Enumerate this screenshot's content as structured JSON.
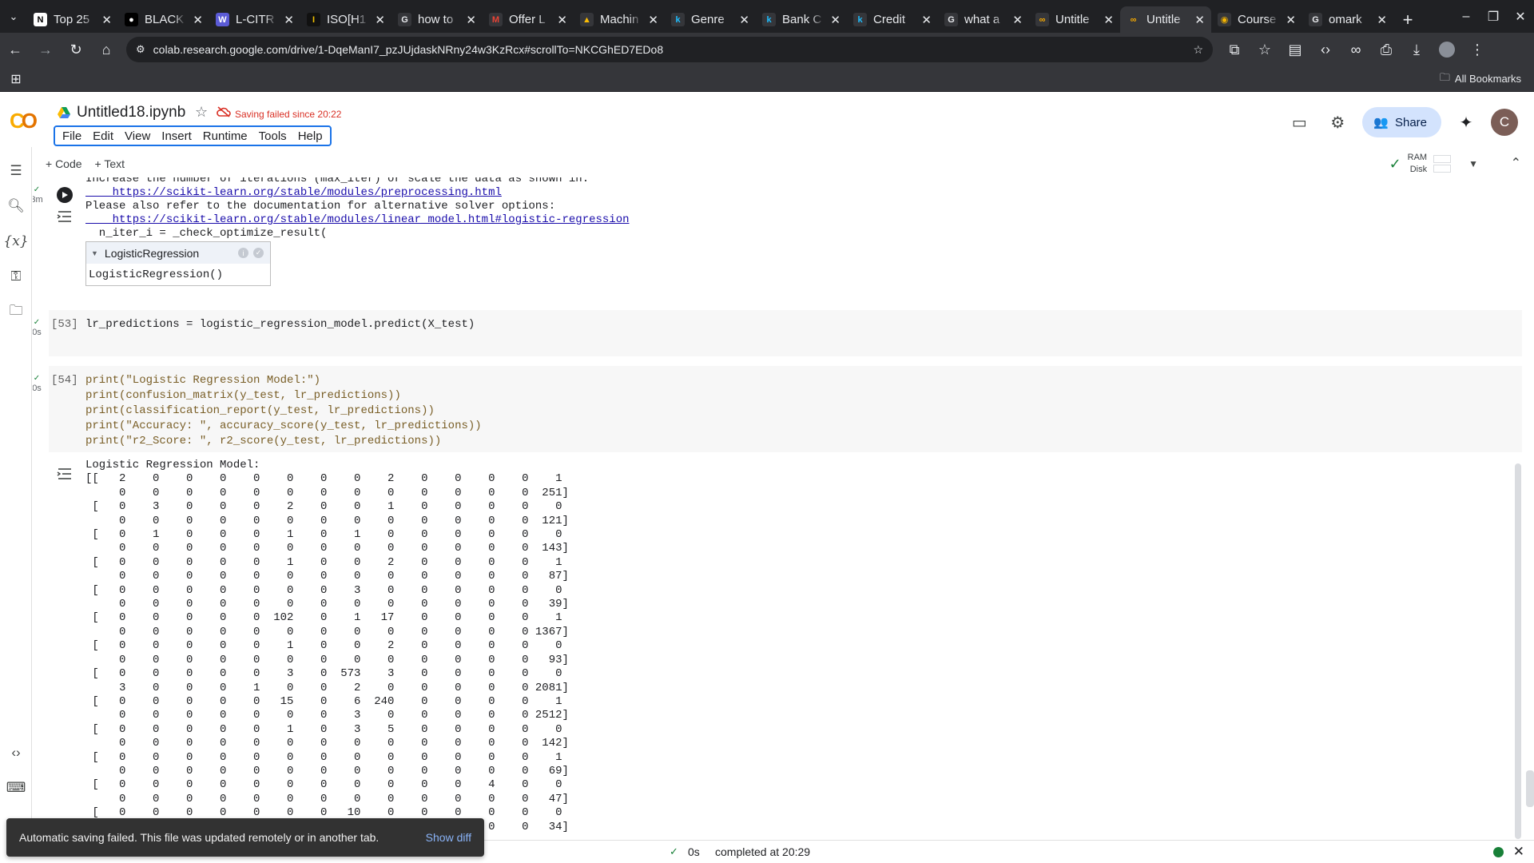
{
  "browser": {
    "tabs": [
      {
        "label": "Top 25",
        "icon": "notion-icon",
        "icon_bg": "#ffffff",
        "icon_fg": "#000000",
        "glyph": "N",
        "active": false
      },
      {
        "label": "BLACK",
        "icon": "github-icon",
        "icon_bg": "#000000",
        "icon_fg": "#ffffff",
        "glyph": "●",
        "active": false
      },
      {
        "label": "L-CITR",
        "icon": "w-icon",
        "icon_bg": "#5b5bd6",
        "icon_fg": "#ffffff",
        "glyph": "W",
        "active": false
      },
      {
        "label": "ISO[H1",
        "icon": "ieee-icon",
        "icon_bg": "#111111",
        "icon_fg": "#f2c200",
        "glyph": "I",
        "active": false
      },
      {
        "label": "how to",
        "icon": "google-icon",
        "icon_bg": "#35363a",
        "icon_fg": "#e8eaed",
        "glyph": "G",
        "active": false
      },
      {
        "label": "Offer L",
        "icon": "gmail-icon",
        "icon_bg": "#35363a",
        "icon_fg": "#ea4335",
        "glyph": "M",
        "active": false
      },
      {
        "label": "Machin",
        "icon": "drive-icon",
        "icon_bg": "#35363a",
        "icon_fg": "#fbbc04",
        "glyph": "▲",
        "active": false
      },
      {
        "label": "Genre",
        "icon": "kaggle-icon",
        "icon_bg": "#35363a",
        "icon_fg": "#20beff",
        "glyph": "k",
        "active": false
      },
      {
        "label": "Bank C",
        "icon": "kaggle-icon",
        "icon_bg": "#35363a",
        "icon_fg": "#20beff",
        "glyph": "k",
        "active": false
      },
      {
        "label": "Credit",
        "icon": "kaggle-icon",
        "icon_bg": "#35363a",
        "icon_fg": "#20beff",
        "glyph": "k",
        "active": false
      },
      {
        "label": "what a",
        "icon": "google-icon",
        "icon_bg": "#35363a",
        "icon_fg": "#e8eaed",
        "glyph": "G",
        "active": false
      },
      {
        "label": "Untitle",
        "icon": "colab-icon",
        "icon_bg": "#35363a",
        "icon_fg": "#f9ab00",
        "glyph": "∞",
        "active": false
      },
      {
        "label": "Untitle",
        "icon": "colab-icon",
        "icon_bg": "#35363a",
        "icon_fg": "#f9ab00",
        "glyph": "∞",
        "active": true
      },
      {
        "label": "Course",
        "icon": "coursera-icon",
        "icon_bg": "#35363a",
        "icon_fg": "#f4b400",
        "glyph": "◉",
        "active": false
      },
      {
        "label": "omark",
        "icon": "google-icon",
        "icon_bg": "#35363a",
        "icon_fg": "#e8eaed",
        "glyph": "G",
        "active": false
      }
    ],
    "url": "colab.research.google.com/drive/1-DqeManI7_pzJUjdaskNRny24w3KzRcx#scrollTo=NKCGhED7EDo8",
    "all_bookmarks": "All Bookmarks"
  },
  "colab": {
    "logo": "CO",
    "title": "Untitled18.ipynb",
    "save_status": "Saving failed since 20:22",
    "menu": [
      "File",
      "Edit",
      "View",
      "Insert",
      "Runtime",
      "Tools",
      "Help"
    ],
    "share_label": "Share",
    "user_initial": "C",
    "add_code": "+ Code",
    "add_text": "+ Text",
    "ram_label": "RAM",
    "disk_label": "Disk"
  },
  "prev_output": {
    "time": "3m",
    "lines": [
      {
        "text": "Increase the number of iterations (max_iter) or scale the data as shown in:",
        "link": false
      },
      {
        "text": "    https://scikit-learn.org/stable/modules/preprocessing.html",
        "link": true
      },
      {
        "text": "Please also refer to the documentation for alternative solver options:",
        "link": false
      },
      {
        "text": "    https://scikit-learn.org/stable/modules/linear_model.html#logistic-regression",
        "link": true
      },
      {
        "text": "  n_iter_i = _check_optimize_result(",
        "link": false
      }
    ],
    "model_box_title": "LogisticRegression",
    "model_box_body": "LogisticRegression()"
  },
  "cells": {
    "c53": {
      "prompt": "[53]",
      "time": "0s",
      "code": "lr_predictions = logistic_regression_model.predict(X_test)"
    },
    "c54": {
      "prompt": "[54]",
      "time": "0s",
      "code_lines": [
        "print(\"Logistic Regression Model:\")",
        "print(confusion_matrix(y_test, lr_predictions))",
        "print(classification_report(y_test, lr_predictions))",
        "print(\"Accuracy: \", accuracy_score(y_test, lr_predictions))",
        "print(\"r2_Score: \", r2_score(y_test, lr_predictions))"
      ],
      "output": "Logistic Regression Model:\n[[   2    0    0    0    0    0    0    0    2    0    0    0    0    1\n     0    0    0    0    0    0    0    0    0    0    0    0    0  251]\n [   0    3    0    0    0    2    0    0    1    0    0    0    0    0\n     0    0    0    0    0    0    0    0    0    0    0    0    0  121]\n [   0    1    0    0    0    1    0    1    0    0    0    0    0    0\n     0    0    0    0    0    0    0    0    0    0    0    0    0  143]\n [   0    0    0    0    0    1    0    0    2    0    0    0    0    1\n     0    0    0    0    0    0    0    0    0    0    0    0    0   87]\n [   0    0    0    0    0    0    0    3    0    0    0    0    0    0\n     0    0    0    0    0    0    0    0    0    0    0    0    0   39]\n [   0    0    0    0    0  102    0    1   17    0    0    0    0    1\n     0    0    0    0    0    0    0    0    0    0    0    0    0 1367]\n [   0    0    0    0    0    1    0    0    2    0    0    0    0    0\n     0    0    0    0    0    0    0    0    0    0    0    0    0   93]\n [   0    0    0    0    0    3    0  573    3    0    0    0    0    0\n     3    0    0    0    1    0    0    2    0    0    0    0    0 2081]\n [   0    0    0    0    0   15    0    6  240    0    0    0    0    1\n     0    0    0    0    0    0    0    3    0    0    0    0    0 2512]\n [   0    0    0    0    0    1    0    3    5    0    0    0    0    0\n     0    0    0    0    0    0    0    0    0    0    0    0    0  142]\n [   0    0    0    0    0    0    0    0    0    0    0    0    0    1\n     0    0    0    0    0    0    0    0    0    0    0    0    0   69]\n [   0    0    0    0    0    0    0    0    0    0    0    4    0    0\n     0    0    0    0    0    0    0    0    0    0    0    0    0   47]\n [   0    0    0    0    0    0    0   10    0    0    0    0    0    0\n     0    0    0    0    0    0    0    0    0    0    0    0    0   34]"
    }
  },
  "snackbar": {
    "message": "Automatic saving failed. This file was updated remotely or in another tab.",
    "action": "Show diff"
  },
  "status": {
    "duration": "0s",
    "completed": "completed at 20:29"
  }
}
